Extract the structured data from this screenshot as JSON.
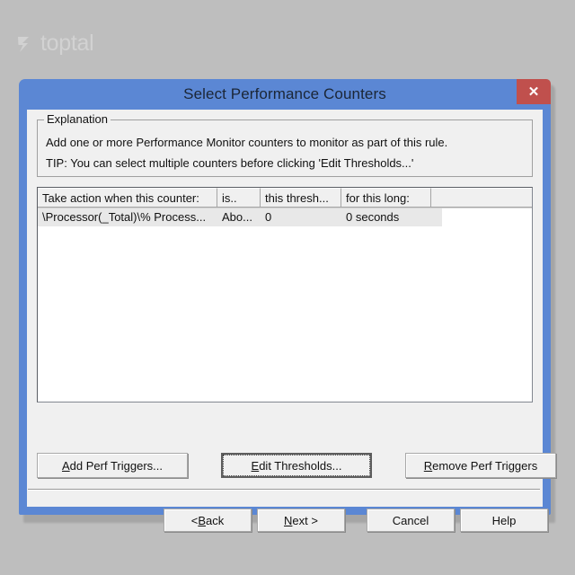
{
  "watermark": {
    "brand": "toptal",
    "logo_icon": "toptal-chevron-icon"
  },
  "dialog": {
    "title": "Select Performance Counters",
    "close_label": "✕",
    "explanation": {
      "legend": "Explanation",
      "line1": "Add one or more Performance Monitor counters to monitor as part of this rule.",
      "line2": "TIP:  You can select multiple counters before clicking 'Edit Thresholds...'"
    },
    "listview": {
      "columns": [
        "Take action when this counter:",
        "is..",
        "this thresh...",
        "for this long:",
        ""
      ],
      "rows": [
        {
          "counter": "\\Processor(_Total)\\% Process...",
          "is": "Abo...",
          "threshold": "0",
          "duration": "0 seconds"
        }
      ]
    },
    "action_buttons": [
      {
        "accel": "A",
        "rest": "dd Perf Triggers...",
        "name": "add-perf-triggers-button"
      },
      {
        "accel": "E",
        "rest": "dit Thresholds...",
        "name": "edit-thresholds-button"
      },
      {
        "accel": "R",
        "rest": "emove Perf Triggers",
        "name": "remove-perf-triggers-button"
      }
    ],
    "nav_buttons": {
      "back_pre": "< ",
      "back_accel": "B",
      "back_rest": "ack",
      "next_accel": "N",
      "next_rest": "ext >",
      "cancel": "Cancel",
      "help": "Help"
    }
  },
  "colors": {
    "page_background": "#bebebe",
    "dialog_frame": "#5b87d4",
    "dialog_face": "#f0f0f0",
    "close_button": "#c0504d",
    "row_selected": "#e8e8e8"
  }
}
